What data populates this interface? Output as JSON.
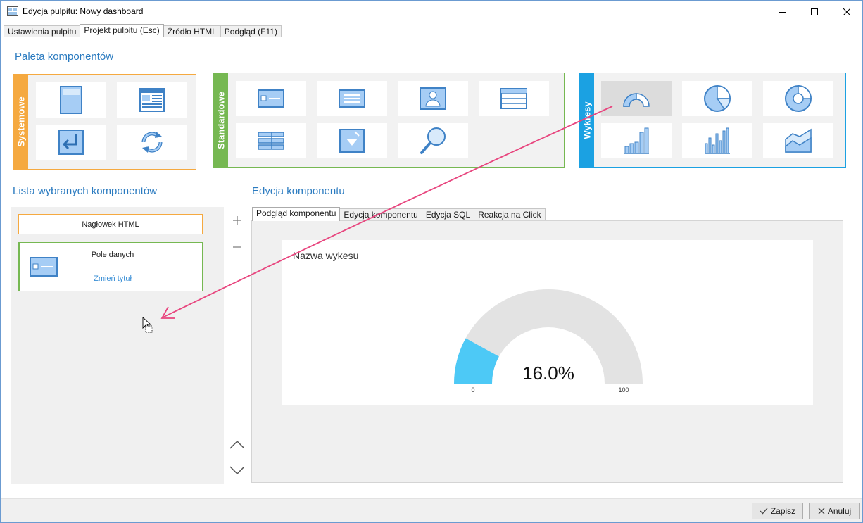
{
  "window": {
    "title": "Edycja pulpitu: Nowy dashboard"
  },
  "tabs": [
    "Ustawienia pulpitu",
    "Projekt pulpitu (Esc)",
    "Źródło HTML",
    "Podgląd (F11)"
  ],
  "palette": {
    "title": "Paleta komponentów",
    "groups": [
      {
        "label": "Systemowe",
        "color": "#f5a940"
      },
      {
        "label": "Standardowe",
        "color": "#76b852"
      },
      {
        "label": "Wykresy",
        "color": "#1ba1e2"
      }
    ]
  },
  "list": {
    "title": "Lista wybranych komponentów",
    "items": [
      {
        "label": "Nagłowek HTML"
      },
      {
        "label": "Pole danych",
        "link": "Zmień tytuł"
      }
    ]
  },
  "editor": {
    "title": "Edycja komponentu",
    "tabs": [
      "Podgląd komponentu",
      "Edycja komponentu",
      "Edycja SQL",
      "Reakcja na Click"
    ]
  },
  "chart_data": {
    "type": "gauge",
    "title": "Nazwa wykesu",
    "value": 16.0,
    "value_label": "16.0%",
    "min_label": "0",
    "max_label": "100",
    "min": 0,
    "max": 100,
    "colors": {
      "fill": "#4dc9f6",
      "track": "#e3e3e3"
    }
  },
  "buttons": {
    "save": "Zapisz",
    "cancel": "Anuluj"
  },
  "colors": {
    "accent": "#2b7bc0",
    "icon_fill": "#a6cdf5",
    "icon_stroke": "#3f82c6",
    "arrow": "#e8457e"
  }
}
